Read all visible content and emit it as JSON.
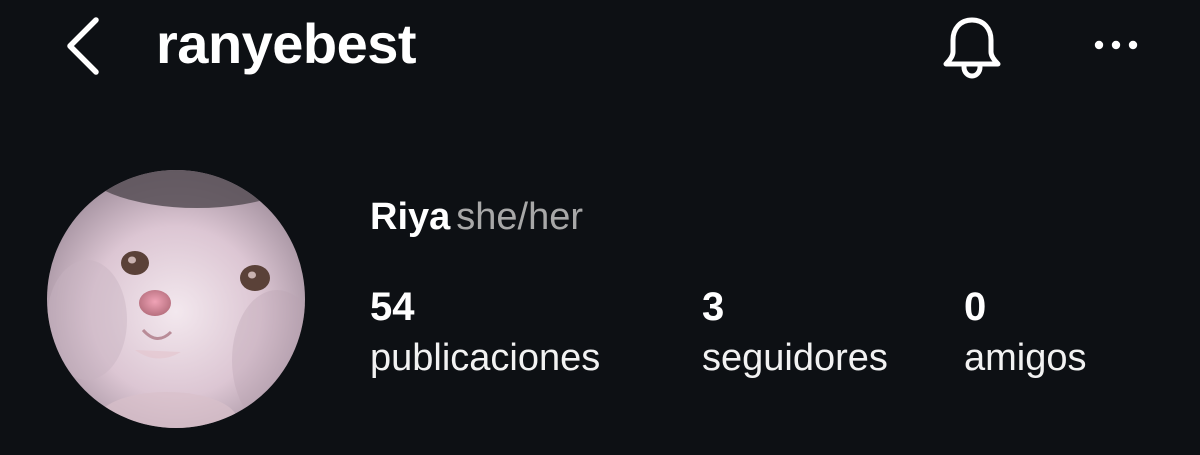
{
  "header": {
    "username": "ranyebest",
    "back_icon": "chevron-left-icon",
    "notifications_icon": "bell-icon",
    "more_icon": "more-horizontal-icon"
  },
  "profile": {
    "display_name": "Riya",
    "pronouns": "she/her",
    "avatar_description_icon": "avatar"
  },
  "stats": [
    {
      "value": "54",
      "label": "publicaciones"
    },
    {
      "value": "3",
      "label": "seguidores"
    },
    {
      "value": "0",
      "label": "amigos"
    }
  ],
  "colors": {
    "background": "#0d1014",
    "text_primary": "#ffffff",
    "text_secondary": "#a8a8a8"
  }
}
